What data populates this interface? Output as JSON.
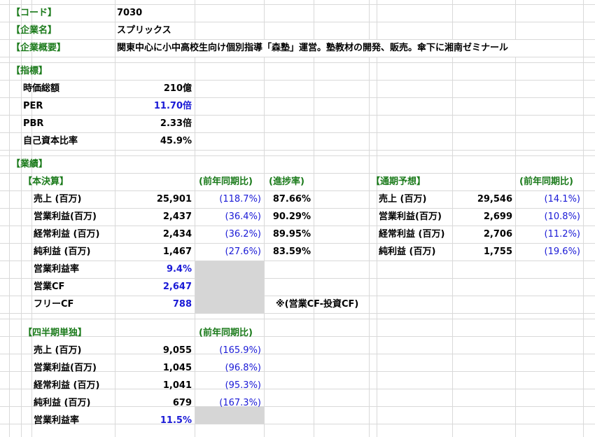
{
  "info": {
    "code_label": "【コード】",
    "code_value": "7030",
    "name_label": "【企業名】",
    "name_value": "スプリックス",
    "overview_label": "【企業概要】",
    "overview_value": "関東中心に小中高校生向け個別指導「森塾」運営。塾教材の開発、販売。傘下に湘南ゼミナール"
  },
  "indicators": {
    "label": "【指標】",
    "rows": [
      {
        "label": "時価総額",
        "value": "210億"
      },
      {
        "label": "PER",
        "value": "11.70倍"
      },
      {
        "label": "PBR",
        "value": "2.33倍"
      },
      {
        "label": "自己資本比率",
        "value": "45.9%"
      }
    ]
  },
  "performance": {
    "label": "【業績】",
    "main": {
      "label": "【本決算】",
      "yoy_header": "(前年同期比)",
      "progress_header": "(進捗率)",
      "rows": [
        {
          "label": "売上 (百万)",
          "value": "25,901",
          "yoy": "(118.7%)",
          "progress": "87.66%"
        },
        {
          "label": "営業利益(百万)",
          "value": "2,437",
          "yoy": "(36.4%)",
          "progress": "90.29%"
        },
        {
          "label": "経常利益 (百万)",
          "value": "2,434",
          "yoy": "(36.2%)",
          "progress": "89.95%"
        },
        {
          "label": "純利益 (百万)",
          "value": "1,467",
          "yoy": "(27.6%)",
          "progress": "83.59%"
        }
      ],
      "extra": [
        {
          "label": "営業利益率",
          "value": "9.4%"
        },
        {
          "label": "営業CF",
          "value": "2,647"
        },
        {
          "label": "フリーCF",
          "value": "788"
        }
      ],
      "note": "※(営業CF-投資CF)"
    },
    "forecast": {
      "label": "【通期予想】",
      "yoy_header": "(前年同期比)",
      "rows": [
        {
          "label": "売上 (百万)",
          "value": "29,546",
          "yoy": "(14.1%)"
        },
        {
          "label": "営業利益(百万)",
          "value": "2,699",
          "yoy": "(10.8%)"
        },
        {
          "label": "経常利益 (百万)",
          "value": "2,706",
          "yoy": "(11.2%)"
        },
        {
          "label": "純利益 (百万)",
          "value": "1,755",
          "yoy": "(19.6%)"
        }
      ]
    },
    "quarter": {
      "label": "【四半期単独】",
      "yoy_header": "(前年同期比)",
      "rows": [
        {
          "label": "売上 (百万)",
          "value": "9,055",
          "yoy": "(165.9%)"
        },
        {
          "label": "営業利益(百万)",
          "value": "1,045",
          "yoy": "(96.8%)"
        },
        {
          "label": "経常利益 (百万)",
          "value": "1,041",
          "yoy": "(95.3%)"
        },
        {
          "label": "純利益 (百万)",
          "value": "679",
          "yoy": "(167.3%)"
        }
      ],
      "margin": {
        "label": "営業利益率",
        "value": "11.5%"
      }
    }
  }
}
